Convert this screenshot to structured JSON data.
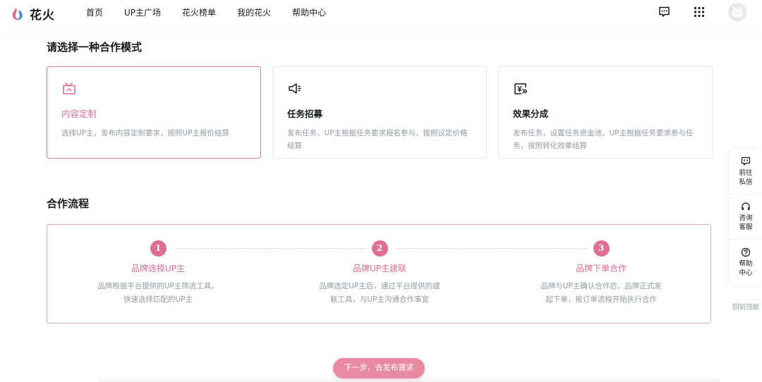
{
  "brand": {
    "name": "花火",
    "accent": "#e06d92"
  },
  "nav": {
    "items": [
      {
        "label": "首页"
      },
      {
        "label": "UP主广场"
      },
      {
        "label": "花火榜单"
      },
      {
        "label": "我的花火"
      },
      {
        "label": "帮助中心"
      }
    ]
  },
  "header_icons": [
    "message-icon",
    "apps-grid-icon",
    "avatar"
  ],
  "mode_section": {
    "title": "请选择一种合作模式",
    "cards": [
      {
        "icon": "tv-icon",
        "title": "内容定制",
        "desc": "选择UP主，发布内容定制要求，按照UP主报价结算",
        "selected": true
      },
      {
        "icon": "megaphone-icon",
        "title": "任务招募",
        "desc": "发布任务，UP主根据任务要求报名参与，按照议定价格结算",
        "selected": false
      },
      {
        "icon": "yen-icon",
        "title": "效果分成",
        "desc": "发布任务，设置任务资金池，UP主根据任务要求参与任务，按照转化效果结算",
        "selected": false
      }
    ]
  },
  "flow_section": {
    "title": "合作流程",
    "steps": [
      {
        "num": "1",
        "title": "品牌选择UP主",
        "desc_line1": "品牌根据平台提供的UP主筛选工具，",
        "desc_line2": "快速选择匹配的UP主"
      },
      {
        "num": "2",
        "title": "品牌UP主建联",
        "desc_line1": "品牌选定UP主后，通过平台提供的建",
        "desc_line2": "联工具，与UP主沟通合作事宜"
      },
      {
        "num": "3",
        "title": "品牌下单合作",
        "desc_line1": "品牌与UP主确认合作后，品牌正式发",
        "desc_line2": "起下单，按订单流程开始执行合作"
      }
    ]
  },
  "next_button": {
    "label": "下一步，去发布需求"
  },
  "side_toolbar": {
    "items": [
      {
        "icon": "chat-icon",
        "label": "前往私信"
      },
      {
        "icon": "headset-icon",
        "label": "咨询客服"
      },
      {
        "icon": "question-icon",
        "label": "帮助中心"
      }
    ],
    "back_top": "回到顶部"
  }
}
